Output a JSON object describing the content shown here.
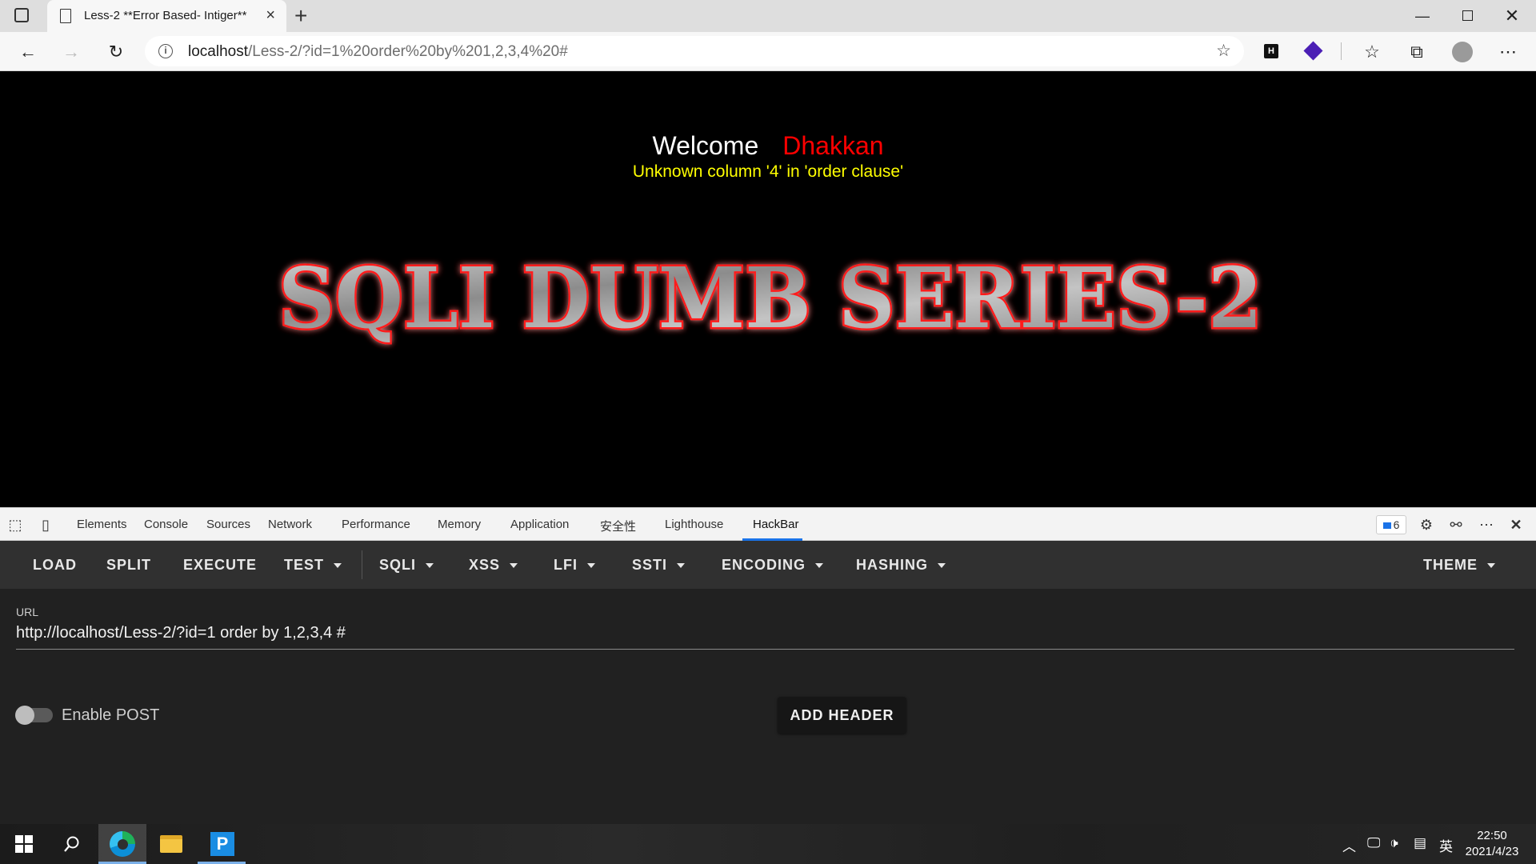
{
  "browser": {
    "tab_title": "Less-2 **Error Based- Intiger**",
    "url_host": "localhost",
    "url_path": "/Less-2/?id=1%20order%20by%201,2,3,4%20#"
  },
  "page": {
    "welcome": "Welcome",
    "username": "Dhakkan",
    "error_message": "Unknown column '4' in 'order clause'",
    "banner_text": "SQLI DUMB SERIES-2"
  },
  "devtools": {
    "tabs": [
      "Elements",
      "Console",
      "Sources",
      "Network",
      "Performance",
      "Memory",
      "Application",
      "安全性",
      "Lighthouse",
      "HackBar"
    ],
    "active_tab": "HackBar",
    "issues_count": "6"
  },
  "hackbar": {
    "buttons": {
      "load": "LOAD",
      "split": "SPLIT",
      "execute": "EXECUTE",
      "test": "TEST",
      "sqli": "SQLI",
      "xss": "XSS",
      "lfi": "LFI",
      "ssti": "SSTI",
      "encoding": "ENCODING",
      "hashing": "HASHING",
      "theme": "THEME"
    },
    "url_label": "URL",
    "url_value": "http://localhost/Less-2/?id=1 order by 1,2,3,4 #",
    "enable_post_label": "Enable POST",
    "enable_post": false,
    "add_header": "ADD HEADER"
  },
  "taskbar": {
    "time": "22:50",
    "date": "2021/4/23",
    "ime": "英"
  },
  "colors": {
    "page_bg": "#000000",
    "username": "#ff0000",
    "error": "#ffff00",
    "hackbar_toolbar": "#303030",
    "hackbar_body": "#212121",
    "accent": "#1a73e8"
  }
}
